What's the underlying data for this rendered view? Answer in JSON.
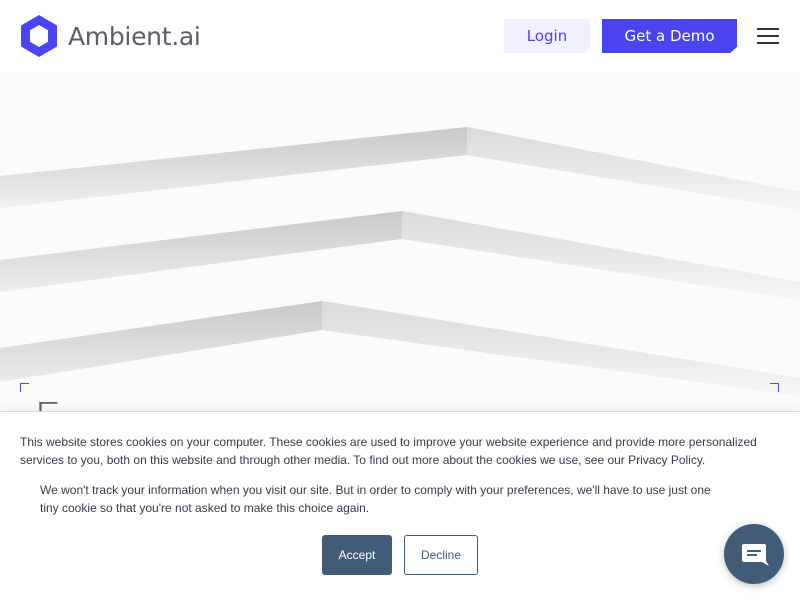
{
  "header": {
    "logo_text": "Ambient.ai",
    "login_label": "Login",
    "demo_label": "Get a Demo",
    "icons": {
      "logo": "hexagon-logo-icon",
      "menu": "hamburger-menu-icon"
    },
    "colors": {
      "brand": "#4a44f2",
      "login_bg": "#f1f0fe",
      "text": "#5b5d6b"
    }
  },
  "hero": {
    "partial_heading": "E"
  },
  "cookie_banner": {
    "text_main": "This website stores cookies on your computer. These cookies are used to improve your website experience and provide more personalized services to you, both on this website and through other media. To find out more about the cookies we use, see our Privacy Policy.",
    "text_secondary": "We won't track your information when you visit our site. But in order to comply with your preferences, we'll have to use just one tiny cookie so that you're not asked to make this choice again.",
    "accept_label": "Accept",
    "decline_label": "Decline",
    "colors": {
      "button": "#425b76",
      "text": "#333c48"
    }
  },
  "chat_widget": {
    "icon": "chat-bubble-icon",
    "color": "#425b76"
  }
}
